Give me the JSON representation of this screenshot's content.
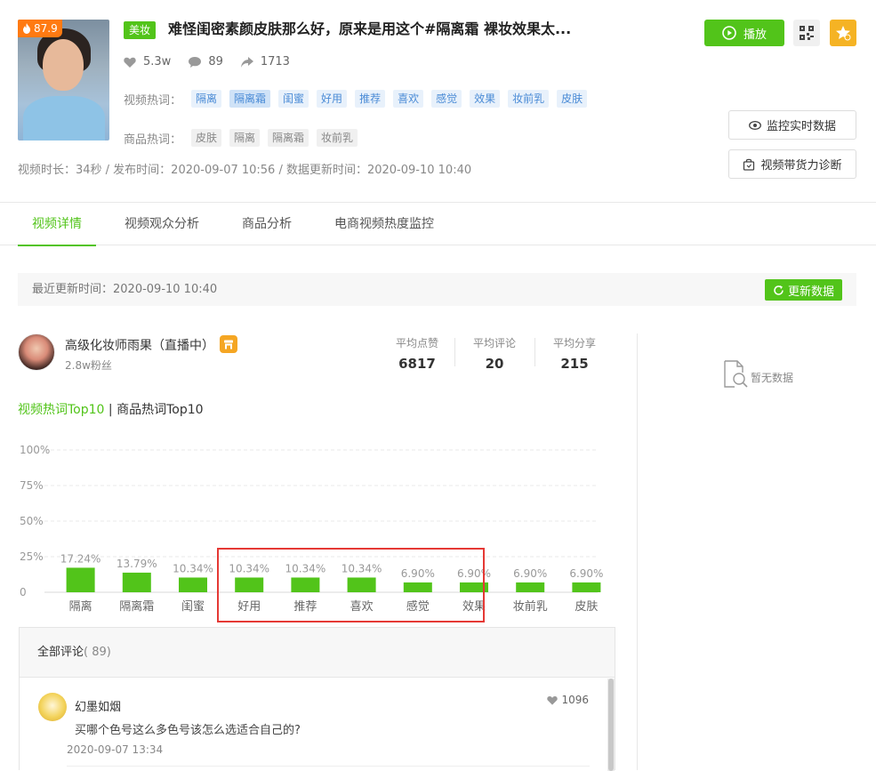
{
  "video": {
    "hot_score": "87.9",
    "category": "美妆",
    "title": "难怪闺密素颜皮肤那么好，原来是用这个#隔离霜 裸妆效果太...",
    "likes": "5.3w",
    "comments": "89",
    "shares": "1713",
    "meta": "视频时长：34秒 / 发布时间：2020-09-07 10:56 / 数据更新时间：2020-09-10 10:40"
  },
  "hot_words": {
    "video_label": "视频热词：",
    "video_tags": [
      "隔离",
      "隔离霜",
      "闺蜜",
      "好用",
      "推荐",
      "喜欢",
      "感觉",
      "效果",
      "妆前乳",
      "皮肤"
    ],
    "product_label": "商品热词：",
    "product_tags": [
      "皮肤",
      "隔离",
      "隔离霜",
      "妆前乳"
    ]
  },
  "actions": {
    "play": "播放",
    "monitor": "监控实时数据",
    "diagnose": "视频带货力诊断"
  },
  "tabs": [
    "视频详情",
    "视频观众分析",
    "商品分析",
    "电商视频热度监控"
  ],
  "update": {
    "text": "最近更新时间：2020-09-10 10:40",
    "button": "更新数据"
  },
  "author": {
    "name": "高级化妆师雨果（直播中）",
    "fans": "2.8w粉丝",
    "avg_like_label": "平均点赞",
    "avg_like": "6817",
    "avg_comment_label": "平均评论",
    "avg_comment": "20",
    "avg_share_label": "平均分享",
    "avg_share": "215"
  },
  "nodata": "暂无数据",
  "keyword_tabs": {
    "active": "视频热词Top10",
    "sep": " | ",
    "inactive": "商品热词Top10"
  },
  "chart_data": {
    "type": "bar",
    "categories": [
      "隔离",
      "隔离霜",
      "闺蜜",
      "好用",
      "推荐",
      "喜欢",
      "感觉",
      "效果",
      "妆前乳",
      "皮肤"
    ],
    "values": [
      17.24,
      13.79,
      10.34,
      10.34,
      10.34,
      10.34,
      6.9,
      6.9,
      6.9,
      6.9
    ],
    "value_labels": [
      "17.24%",
      "13.79%",
      "10.34%",
      "10.34%",
      "10.34%",
      "10.34%",
      "6.90%",
      "6.90%",
      "6.90%",
      "6.90%"
    ],
    "y_ticks": [
      "0",
      "25%",
      "50%",
      "75%",
      "100%"
    ],
    "ylim": [
      0,
      100
    ],
    "bar_color": "#52c41a",
    "grid": true
  },
  "comments": {
    "header": "全部评论",
    "count": "( 89)",
    "items": [
      {
        "user": "幻墨如烟",
        "text": "买哪个色号这么多色号该怎么选适合自己的?",
        "date": "2020-09-07 13:34",
        "likes": "1096"
      }
    ]
  },
  "colors": {
    "accent": "#52c41a",
    "orange": "#ff7a12",
    "star": "#f5b324",
    "highlight": "#e53935"
  }
}
